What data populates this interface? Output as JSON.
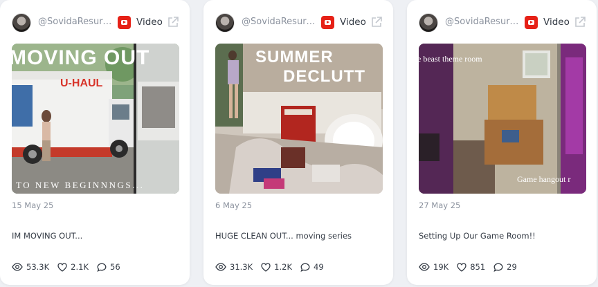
{
  "cards": [
    {
      "handle": "@SovidaResurr...",
      "platform_label": "Video",
      "thumb_text_top": "MOVING OUT",
      "thumb_text_bottom": "TO NEW BEGINNNGS...",
      "truck_text": "U-HAUL",
      "date": "15 May 25",
      "title": "IM MOVING OUT...",
      "views": "53.3K",
      "likes": "2.1K",
      "comments": "56"
    },
    {
      "handle": "@SovidaResurr...",
      "platform_label": "Video",
      "thumb_text_top": "SUMMER",
      "thumb_text_bottom": "DECLUTT",
      "date": "6 May 25",
      "title": "HUGE CLEAN OUT... moving series",
      "views": "31.3K",
      "likes": "1.2K",
      "comments": "49"
    },
    {
      "handle": "@SovidaResurr...",
      "platform_label": "Video",
      "thumb_text_top": "e beast theme room",
      "thumb_text_bottom": "Game hangout r",
      "date": "27 May 25",
      "title": "Setting Up Our Game Room!!",
      "views": "19K",
      "likes": "851",
      "comments": "29"
    }
  ],
  "icons": {
    "platform": "youtube-icon",
    "external": "external-link-icon",
    "views": "eye-icon",
    "likes": "heart-icon",
    "comments": "comment-icon"
  },
  "colors": {
    "youtube_red": "#e62117",
    "text": "#333a44",
    "muted": "#8b929e"
  }
}
